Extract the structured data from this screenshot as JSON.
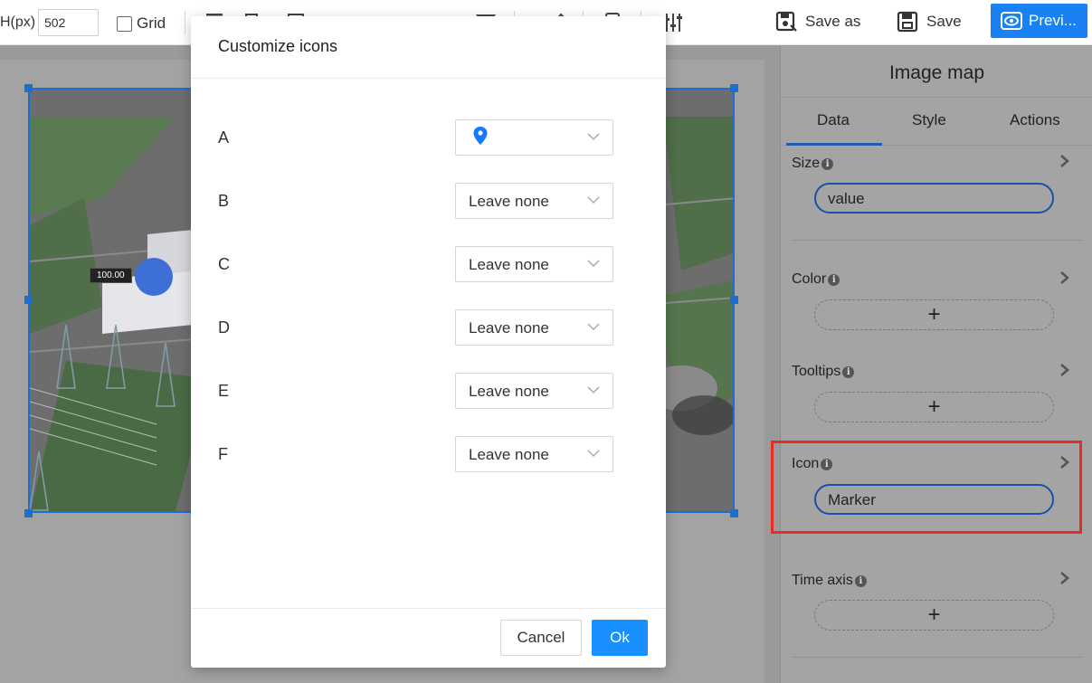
{
  "toolbar": {
    "height_label": "H(px)",
    "height_value": "502",
    "grid_label": "Grid",
    "save_as_label": "Save as",
    "save_label": "Save",
    "preview_label": "Previ..."
  },
  "canvas": {
    "marker_value": "100.00"
  },
  "panel": {
    "title": "Image map",
    "tabs": [
      {
        "label": "Data",
        "active": true
      },
      {
        "label": "Style",
        "active": false
      },
      {
        "label": "Actions",
        "active": false
      }
    ],
    "sections": {
      "size": {
        "label": "Size",
        "value": "value"
      },
      "color": {
        "label": "Color"
      },
      "tooltips": {
        "label": "Tooltips"
      },
      "icon": {
        "label": "Icon",
        "value": "Marker"
      },
      "time_axis": {
        "label": "Time axis"
      }
    },
    "add_symbol": "+"
  },
  "modal": {
    "title": "Customize icons",
    "rows": [
      {
        "label": "A",
        "value": "",
        "icon": "map-pin-icon"
      },
      {
        "label": "B",
        "value": "Leave none"
      },
      {
        "label": "C",
        "value": "Leave none"
      },
      {
        "label": "D",
        "value": "Leave none"
      },
      {
        "label": "E",
        "value": "Leave none"
      },
      {
        "label": "F",
        "value": "Leave none"
      }
    ],
    "cancel_label": "Cancel",
    "ok_label": "Ok"
  },
  "colors": {
    "primary": "#1890ff",
    "preview_button": "#1a81f3",
    "highlight": "#ea2b24",
    "selection": "#1c6fd1"
  }
}
